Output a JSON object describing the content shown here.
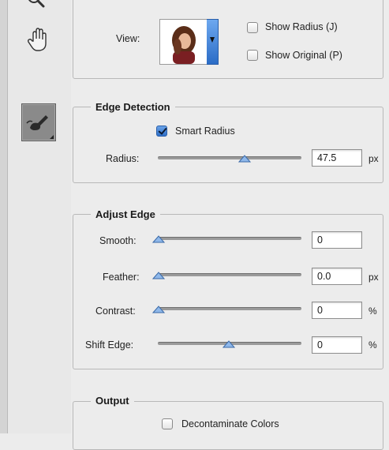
{
  "view_section": {
    "view_label": "View:",
    "show_radius_label": "Show Radius (J)",
    "show_original_label": "Show Original (P)"
  },
  "edge_detection": {
    "title": "Edge Detection",
    "smart_radius_label": "Smart Radius",
    "smart_radius_checked": true,
    "radius_label": "Radius:",
    "radius_value": "47.5",
    "radius_unit": "px",
    "radius_level": 0.55
  },
  "adjust_edge": {
    "title": "Adjust Edge",
    "smooth_label": "Smooth:",
    "smooth_value": "0",
    "smooth_level": 0.0,
    "feather_label": "Feather:",
    "feather_value": "0.0",
    "feather_unit": "px",
    "feather_level": 0.0,
    "contrast_label": "Contrast:",
    "contrast_value": "0",
    "contrast_unit": "%",
    "contrast_level": 0.0,
    "shift_label": "Shift Edge:",
    "shift_value": "0",
    "shift_unit": "%",
    "shift_level": 0.5
  },
  "output": {
    "title": "Output",
    "decontaminate_label": "Decontaminate Colors"
  },
  "colors": {
    "checkbox_checked": "#3f7fd6",
    "slider_thumb": "#8fb8ea"
  }
}
